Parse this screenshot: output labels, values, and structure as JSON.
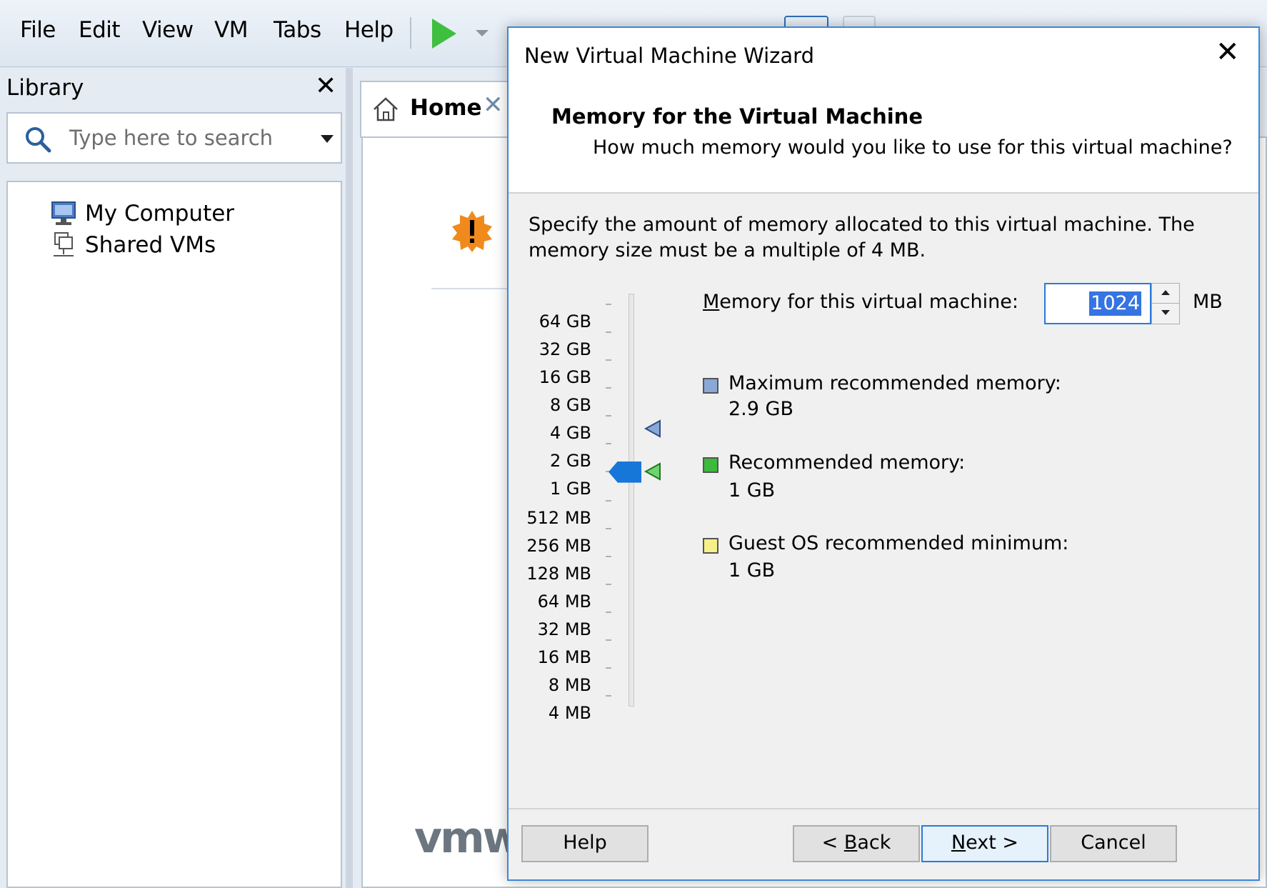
{
  "menubar": {
    "items": [
      "File",
      "Edit",
      "View",
      "VM",
      "Tabs",
      "Help"
    ]
  },
  "library": {
    "title": "Library",
    "close": "✕",
    "search": {
      "placeholder": "Type here to search",
      "value": ""
    },
    "tree": [
      {
        "label": "My Computer",
        "icon": "monitor-icon"
      },
      {
        "label": "Shared VMs",
        "icon": "shared-vms-icon"
      }
    ]
  },
  "home": {
    "tab_label": "Home",
    "tab_close": "✕",
    "logo_text": "vmwa"
  },
  "wizard": {
    "title": "New Virtual Machine Wizard",
    "close": "✕",
    "heading": "Memory for the Virtual Machine",
    "subheading": "How much memory would you like to use for this virtual machine?",
    "description": "Specify the amount of memory allocated to this virtual machine. The memory size must be a multiple of 4 MB.",
    "memory_label_prefix": "M",
    "memory_label_rest": "emory for this virtual machine:",
    "memory_value": "1024",
    "memory_unit": "MB",
    "scale": [
      "64 GB",
      "32 GB",
      "16 GB",
      "8 GB",
      "4 GB",
      "2 GB",
      "1 GB",
      "512 MB",
      "256 MB",
      "128 MB",
      "64 MB",
      "32 MB",
      "16 MB",
      "8 MB",
      "4 MB"
    ],
    "slider_value": "1 GB",
    "legend": [
      {
        "label": "Maximum recommended memory:",
        "value": "2.9 GB",
        "color": "#8aa8d6"
      },
      {
        "label": "Recommended memory:",
        "value": "1 GB",
        "color": "#3cba3c"
      },
      {
        "label": "Guest OS recommended minimum:",
        "value": "1 GB",
        "color": "#f6f08a"
      }
    ],
    "buttons": {
      "help": "Help",
      "back_prefix": "< ",
      "back_accel": "B",
      "back_rest": "ack",
      "next_accel": "N",
      "next_rest": "ext >",
      "cancel": "Cancel"
    }
  },
  "colors": {
    "accent": "#1777d9",
    "dialog_border": "#3d88d8"
  }
}
